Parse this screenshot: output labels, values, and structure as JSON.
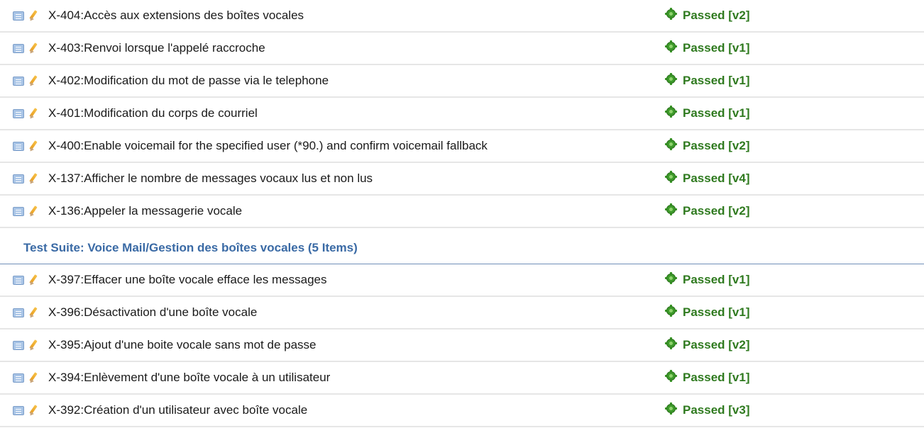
{
  "group1": [
    {
      "title": "X-404:Accès aux extensions des boîtes vocales",
      "status": "Passed [v2]"
    },
    {
      "title": "X-403:Renvoi lorsque l'appelé raccroche",
      "status": "Passed [v1]"
    },
    {
      "title": "X-402:Modification du mot de passe via le telephone",
      "status": "Passed [v1]"
    },
    {
      "title": "X-401:Modification du corps de courriel",
      "status": "Passed [v1]"
    },
    {
      "title": "X-400:Enable voicemail for the specified user (*90.) and confirm voicemail fallback",
      "status": "Passed [v2]"
    },
    {
      "title": "X-137:Afficher le nombre de messages vocaux lus et non lus",
      "status": "Passed [v4]"
    },
    {
      "title": "X-136:Appeler la messagerie vocale",
      "status": "Passed [v2]"
    }
  ],
  "suite": {
    "label": "Test Suite: Voice Mail/Gestion des boîtes vocales (5 Items)"
  },
  "group2": [
    {
      "title": "X-397:Effacer une boîte vocale efface les messages",
      "status": "Passed [v1]"
    },
    {
      "title": "X-396:Désactivation d'une boîte vocale",
      "status": "Passed [v1]"
    },
    {
      "title": "X-395:Ajout d'une boite vocale sans mot de passe",
      "status": "Passed [v2]"
    },
    {
      "title": "X-394:Enlèvement d'une boîte vocale à un utilisateur",
      "status": "Passed [v1]"
    },
    {
      "title": "X-392:Création d'un utilisateur avec boîte vocale",
      "status": "Passed [v3]"
    }
  ],
  "icons": {
    "view": "book-icon",
    "edit": "pencil-icon",
    "status": "gear-icon"
  },
  "colors": {
    "passed": "#2f7a1f",
    "suite_link": "#3a6aa5",
    "divider": "#e6e6e6"
  }
}
